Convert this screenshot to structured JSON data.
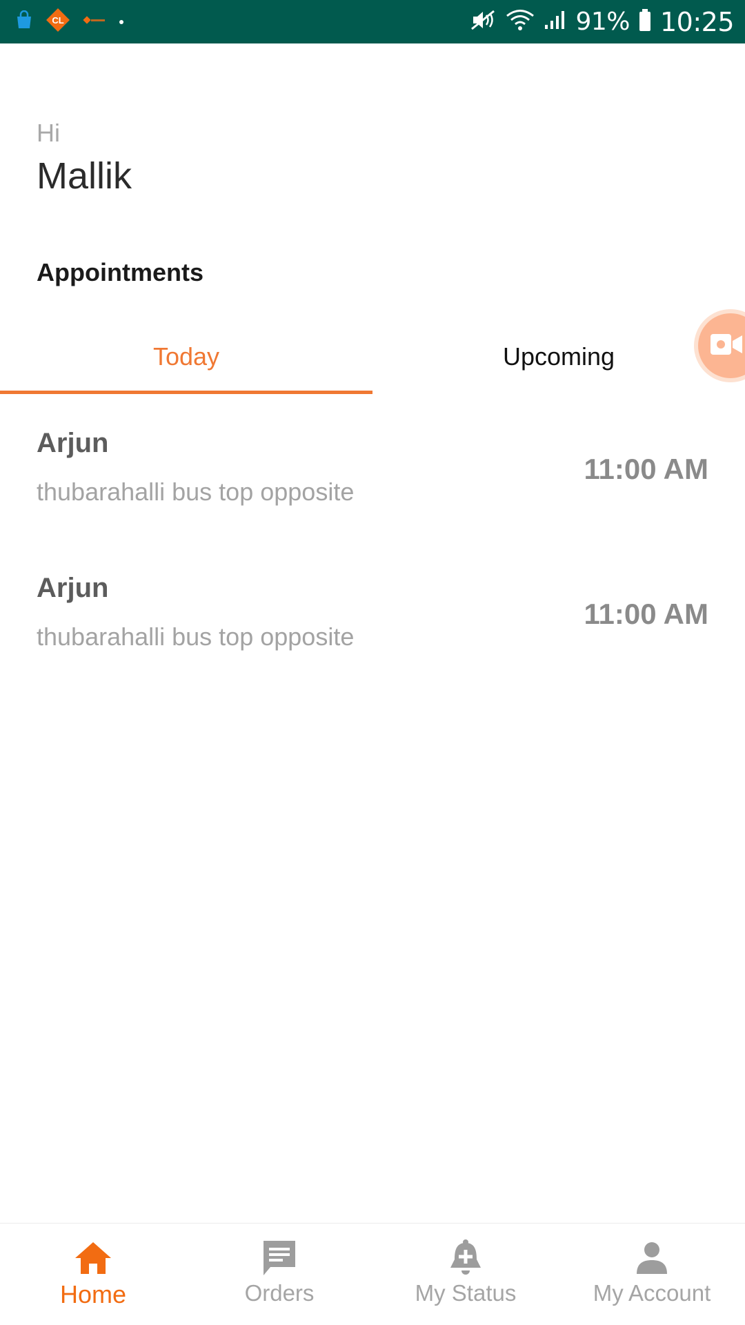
{
  "status_bar": {
    "battery": "91%",
    "time": "10:25",
    "icons": [
      "bag-icon",
      "cl-app-icon",
      "app-logo-icon",
      "dot-icon",
      "mute-icon",
      "wifi-icon",
      "signal-icon",
      "battery-icon"
    ]
  },
  "greeting": {
    "hi": "Hi",
    "name": "Mallik"
  },
  "appointments": {
    "title": "Appointments",
    "tabs": [
      {
        "label": "Today",
        "active": true
      },
      {
        "label": "Upcoming",
        "active": false
      }
    ],
    "items": [
      {
        "name": "Arjun",
        "address": "thubarahalli bus top opposite",
        "time": "11:00 AM"
      },
      {
        "name": "Arjun",
        "address": "thubarahalli bus top opposite",
        "time": "11:00 AM"
      }
    ]
  },
  "bottom_nav": {
    "items": [
      {
        "label": "Home",
        "icon": "home-icon",
        "active": true
      },
      {
        "label": "Orders",
        "icon": "chat-icon",
        "active": false
      },
      {
        "label": "My Status",
        "icon": "bell-plus-icon",
        "active": false
      },
      {
        "label": "My Account",
        "icon": "person-icon",
        "active": false
      }
    ]
  },
  "colors": {
    "status_bar": "#015a4e",
    "accent": "#f07833",
    "nav_active": "#f26c12",
    "inactive": "#a5a5a5"
  }
}
